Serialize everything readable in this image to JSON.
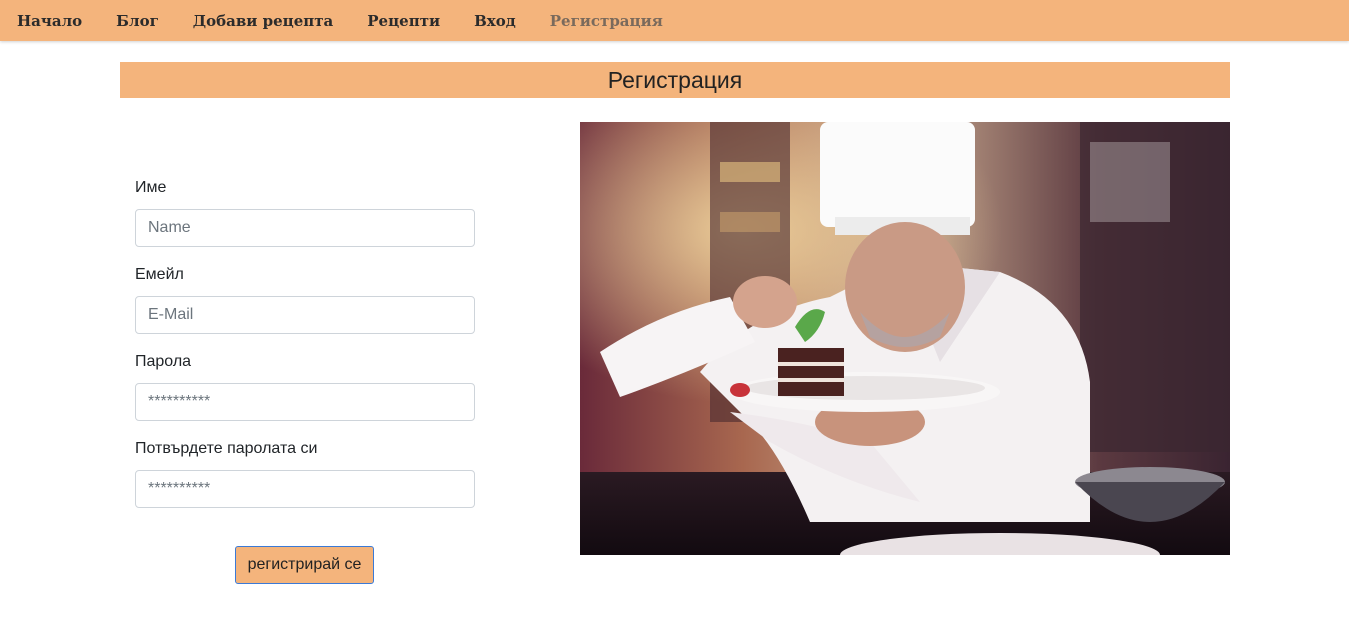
{
  "nav": {
    "items": [
      {
        "label": "Начало"
      },
      {
        "label": "Блог"
      },
      {
        "label": "Добави рецепта"
      },
      {
        "label": "Рецепти"
      },
      {
        "label": "Вход"
      },
      {
        "label": "Регистрация",
        "active": true
      }
    ]
  },
  "page": {
    "title": "Регистрация"
  },
  "form": {
    "name": {
      "label": "Име",
      "placeholder": "Name"
    },
    "email": {
      "label": "Емейл",
      "placeholder": "E-Mail"
    },
    "password": {
      "label": "Парола",
      "placeholder": "**********"
    },
    "confirm_password": {
      "label": "Потвърдете паролата си",
      "placeholder": "**********"
    },
    "submit_label": "регистрирай се"
  },
  "image": {
    "icon": "chef-plating-cake-photo"
  },
  "colors": {
    "accent": "#f4b47c",
    "button_border": "#3b7ad6"
  }
}
